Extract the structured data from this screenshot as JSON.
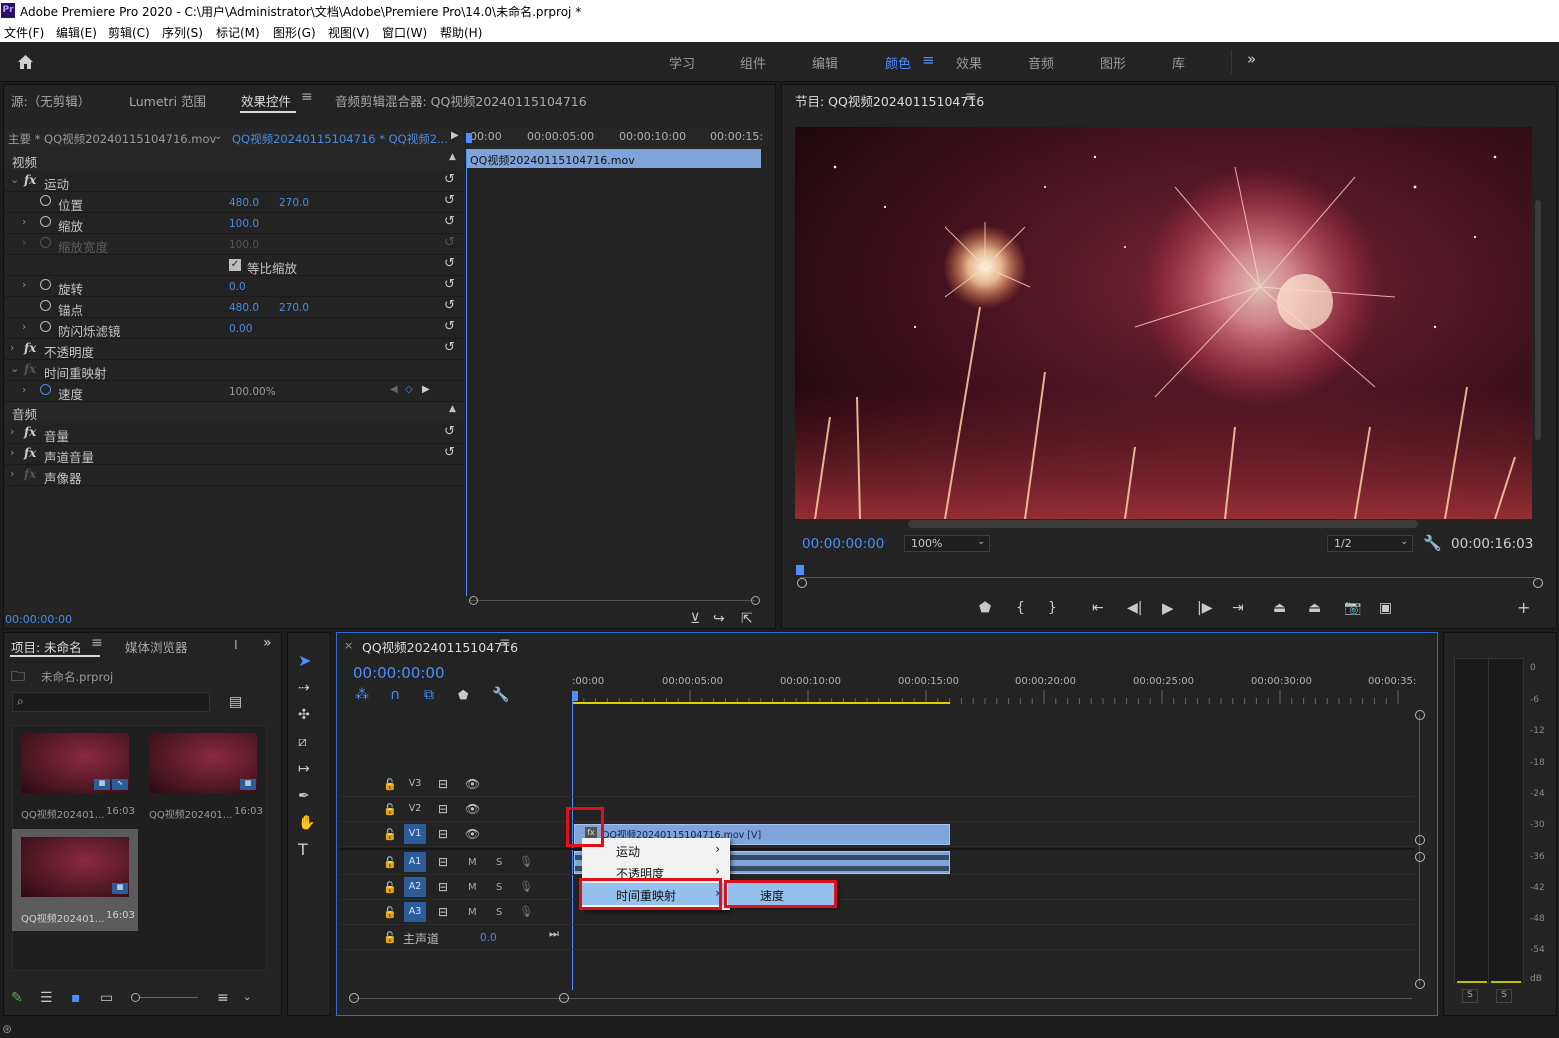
{
  "window": {
    "app_icon": "Pr",
    "title": "Adobe Premiere Pro 2020 - C:\\用户\\Administrator\\文档\\Adobe\\Premiere Pro\\14.0\\未命名.prproj *"
  },
  "menu": [
    "文件(F)",
    "编辑(E)",
    "剪辑(C)",
    "序列(S)",
    "标记(M)",
    "图形(G)",
    "视图(V)",
    "窗口(W)",
    "帮助(H)"
  ],
  "workspaces": {
    "items": [
      "学习",
      "组件",
      "编辑",
      "颜色",
      "效果",
      "音频",
      "图形",
      "库"
    ],
    "active": "颜色",
    "more_label": "»"
  },
  "source_panel": {
    "tabs": [
      "源:（无剪辑）",
      "Lumetri 范围",
      "效果控件",
      "音频剪辑混合器: QQ视频20240115104716"
    ],
    "active_tab": "效果控件",
    "clip_selector": "主要 * QQ视频20240115104716.mov",
    "sequence_clip": "QQ视频20240115104716 * QQ视频2...",
    "mini_ruler": [
      "00:00",
      "00:00:05:00",
      "00:00:10:00",
      "00:00:15:"
    ],
    "mini_clip_label": "QQ视频20240115104716.mov",
    "sections": {
      "video": "视频",
      "audio": "音频"
    },
    "rows": [
      {
        "label": "运动",
        "type": "fx"
      },
      {
        "label": "位置",
        "v1": "480.0",
        "v2": "270.0"
      },
      {
        "label": "缩放",
        "v1": "100.0"
      },
      {
        "label": "缩放宽度",
        "v1": "100.0",
        "dim": true
      },
      {
        "label": "等比缩放",
        "checkbox": true
      },
      {
        "label": "旋转",
        "v1": "0.0"
      },
      {
        "label": "锚点",
        "v1": "480.0",
        "v2": "270.0"
      },
      {
        "label": "防闪烁滤镜",
        "v1": "0.00"
      },
      {
        "label": "不透明度",
        "type": "fx"
      },
      {
        "label": "时间重映射",
        "type": "fx"
      },
      {
        "label": "速度",
        "v1": "100.00%"
      }
    ],
    "audio_rows": [
      "音量",
      "声道音量",
      "声像器"
    ],
    "timecode": "00:00:00:00"
  },
  "program_monitor": {
    "title": "节目: QQ视频20240115104716",
    "timecode": "00:00:00:00",
    "zoom": "100%",
    "resolution": "1/2",
    "duration": "00:00:16:03"
  },
  "project_panel": {
    "tabs": [
      "项目: 未命名",
      "媒体浏览器",
      "I"
    ],
    "file": "未命名.prproj",
    "search_placeholder": "",
    "items": [
      {
        "name": "QQ视频202401...",
        "duration": "16:03"
      },
      {
        "name": "QQ视频202401...",
        "duration": "16:03"
      },
      {
        "name": "QQ视频202401...",
        "duration": "16:03"
      }
    ]
  },
  "timeline": {
    "title": "QQ视频20240115104716",
    "timecode": "00:00:00:00",
    "ruler": [
      ":00:00",
      "00:00:05:00",
      "00:00:10:00",
      "00:00:15:00",
      "00:00:20:00",
      "00:00:25:00",
      "00:00:30:00",
      "00:00:35:"
    ],
    "video_tracks": [
      "V3",
      "V2",
      "V1"
    ],
    "audio_tracks": [
      "A1",
      "A2",
      "A3"
    ],
    "master": {
      "label": "主声道",
      "value": "0.0"
    },
    "clip_label": "QQ视频20240115104716.mov [V]",
    "mute": "M",
    "solo": "S"
  },
  "context_menu": {
    "items": [
      "运动",
      "不透明度",
      "时间重映射"
    ],
    "highlighted": "时间重映射",
    "submenu": [
      "速度"
    ]
  },
  "audio_meter": {
    "scale": [
      "0",
      "-6",
      "-12",
      "-18",
      "-24",
      "-30",
      "-36",
      "-42",
      "-48",
      "-54",
      "dB"
    ],
    "solo": [
      "S",
      "S"
    ]
  },
  "colors": {
    "accent": "#4d8eff",
    "highlight_red": "#e0101a",
    "clip_blue": "#7ea4d9"
  }
}
